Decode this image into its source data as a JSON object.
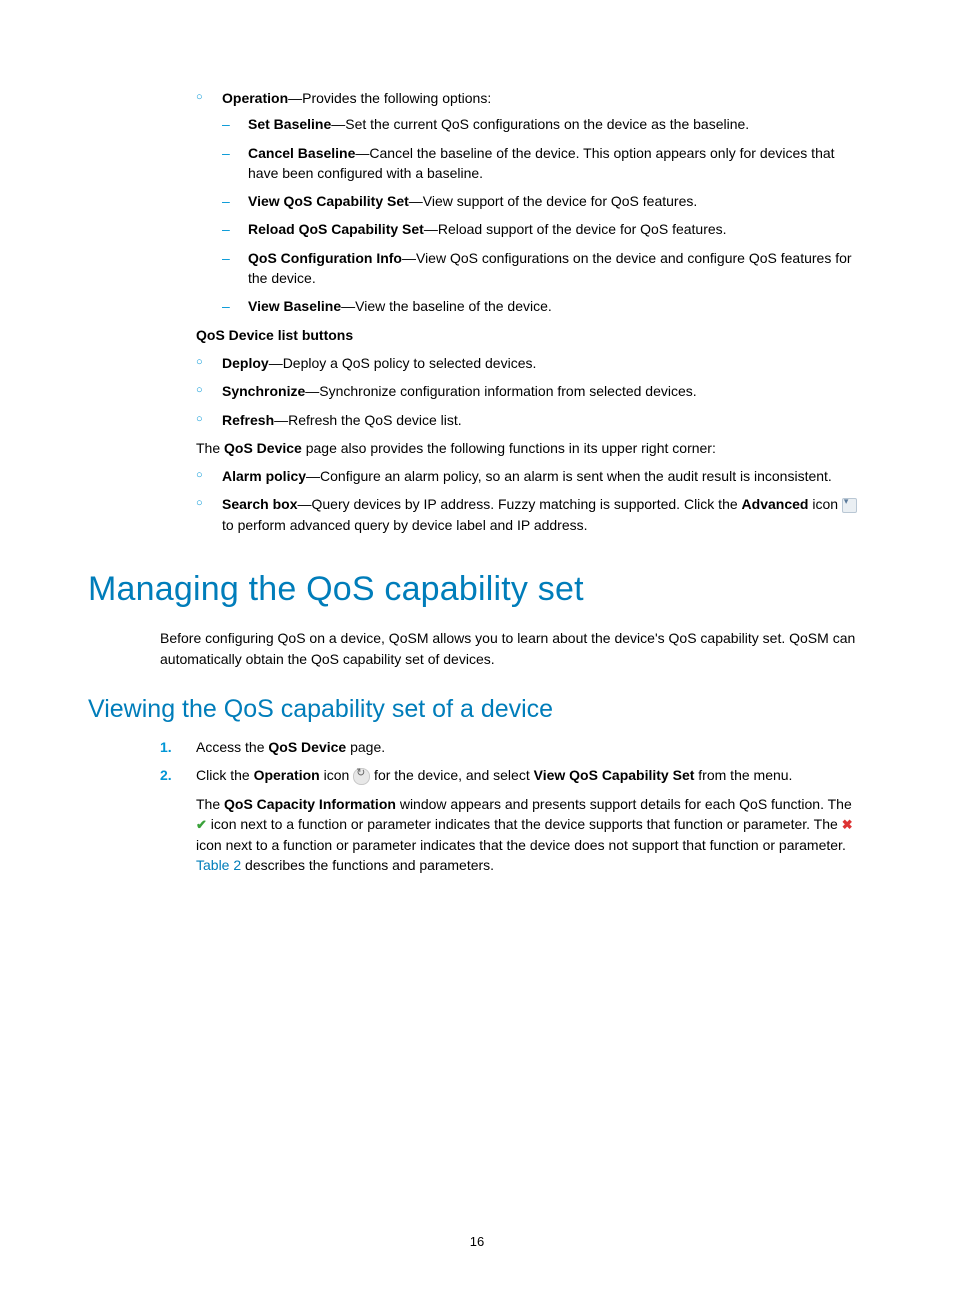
{
  "operation": {
    "label": "Operation",
    "desc": "—Provides the following options:",
    "items": [
      {
        "name": "Set Baseline",
        "desc": "—Set the current QoS configurations on the device as the baseline."
      },
      {
        "name": "Cancel Baseline",
        "desc": "—Cancel the baseline of the device. This option appears only for devices that have been configured with a baseline."
      },
      {
        "name": "View QoS Capability Set",
        "desc": "—View support of the device for QoS features."
      },
      {
        "name": "Reload QoS Capability Set",
        "desc": "—Reload support of the device for QoS features."
      },
      {
        "name": "QoS Configuration Info",
        "desc": "—View QoS configurations on the device and configure QoS features for the device."
      },
      {
        "name": "View Baseline",
        "desc": "—View the baseline of the device."
      }
    ]
  },
  "buttons_heading": "QoS Device list buttons",
  "buttons": [
    {
      "name": "Deploy",
      "desc": "—Deploy a QoS policy to selected devices."
    },
    {
      "name": "Synchronize",
      "desc": "—Synchronize configuration information from selected devices."
    },
    {
      "name": "Refresh",
      "desc": "—Refresh the QoS device list."
    }
  ],
  "page_note": {
    "prefix": "The ",
    "bold": "QoS Device",
    "suffix": " page also provides the following functions in its upper right corner:"
  },
  "corner_funcs": {
    "alarm": {
      "name": "Alarm policy",
      "desc": "—Configure an alarm policy, so an alarm is sent when the audit result is inconsistent."
    },
    "search": {
      "name": "Search box",
      "desc_before": "—Query devices by IP address. Fuzzy matching is supported. Click the ",
      "bold": "Advanced",
      "desc_mid": " icon ",
      "desc_after": " to perform advanced query by device label and IP address."
    }
  },
  "h1": "Managing the QoS capability set",
  "intro": "Before configuring QoS on a device, QoSM allows you to learn about the device's QoS capability set. QoSM can automatically obtain the QoS capability set of devices.",
  "h2": "Viewing the QoS capability set of a device",
  "steps": {
    "one": {
      "num": "1.",
      "prefix": "Access the ",
      "bold": "QoS Device",
      "suffix": " page."
    },
    "two": {
      "num": "2.",
      "p1_a": "Click the ",
      "p1_b": "Operation",
      "p1_c": " icon ",
      "p1_d": " for the device, and select ",
      "p1_e": "View QoS Capability Set",
      "p1_f": " from the menu.",
      "p2_a": "The ",
      "p2_b": "QoS Capacity Information",
      "p2_c": " window appears and presents support details for each QoS function. The ",
      "p2_d": " icon next to a function or parameter indicates that the device supports that function or parameter. The ",
      "p2_e": " icon next to a function or parameter indicates that the device does not support that function or parameter. ",
      "p2_link": "Table 2",
      "p2_f": " describes the functions and parameters."
    }
  },
  "page_number": "16"
}
